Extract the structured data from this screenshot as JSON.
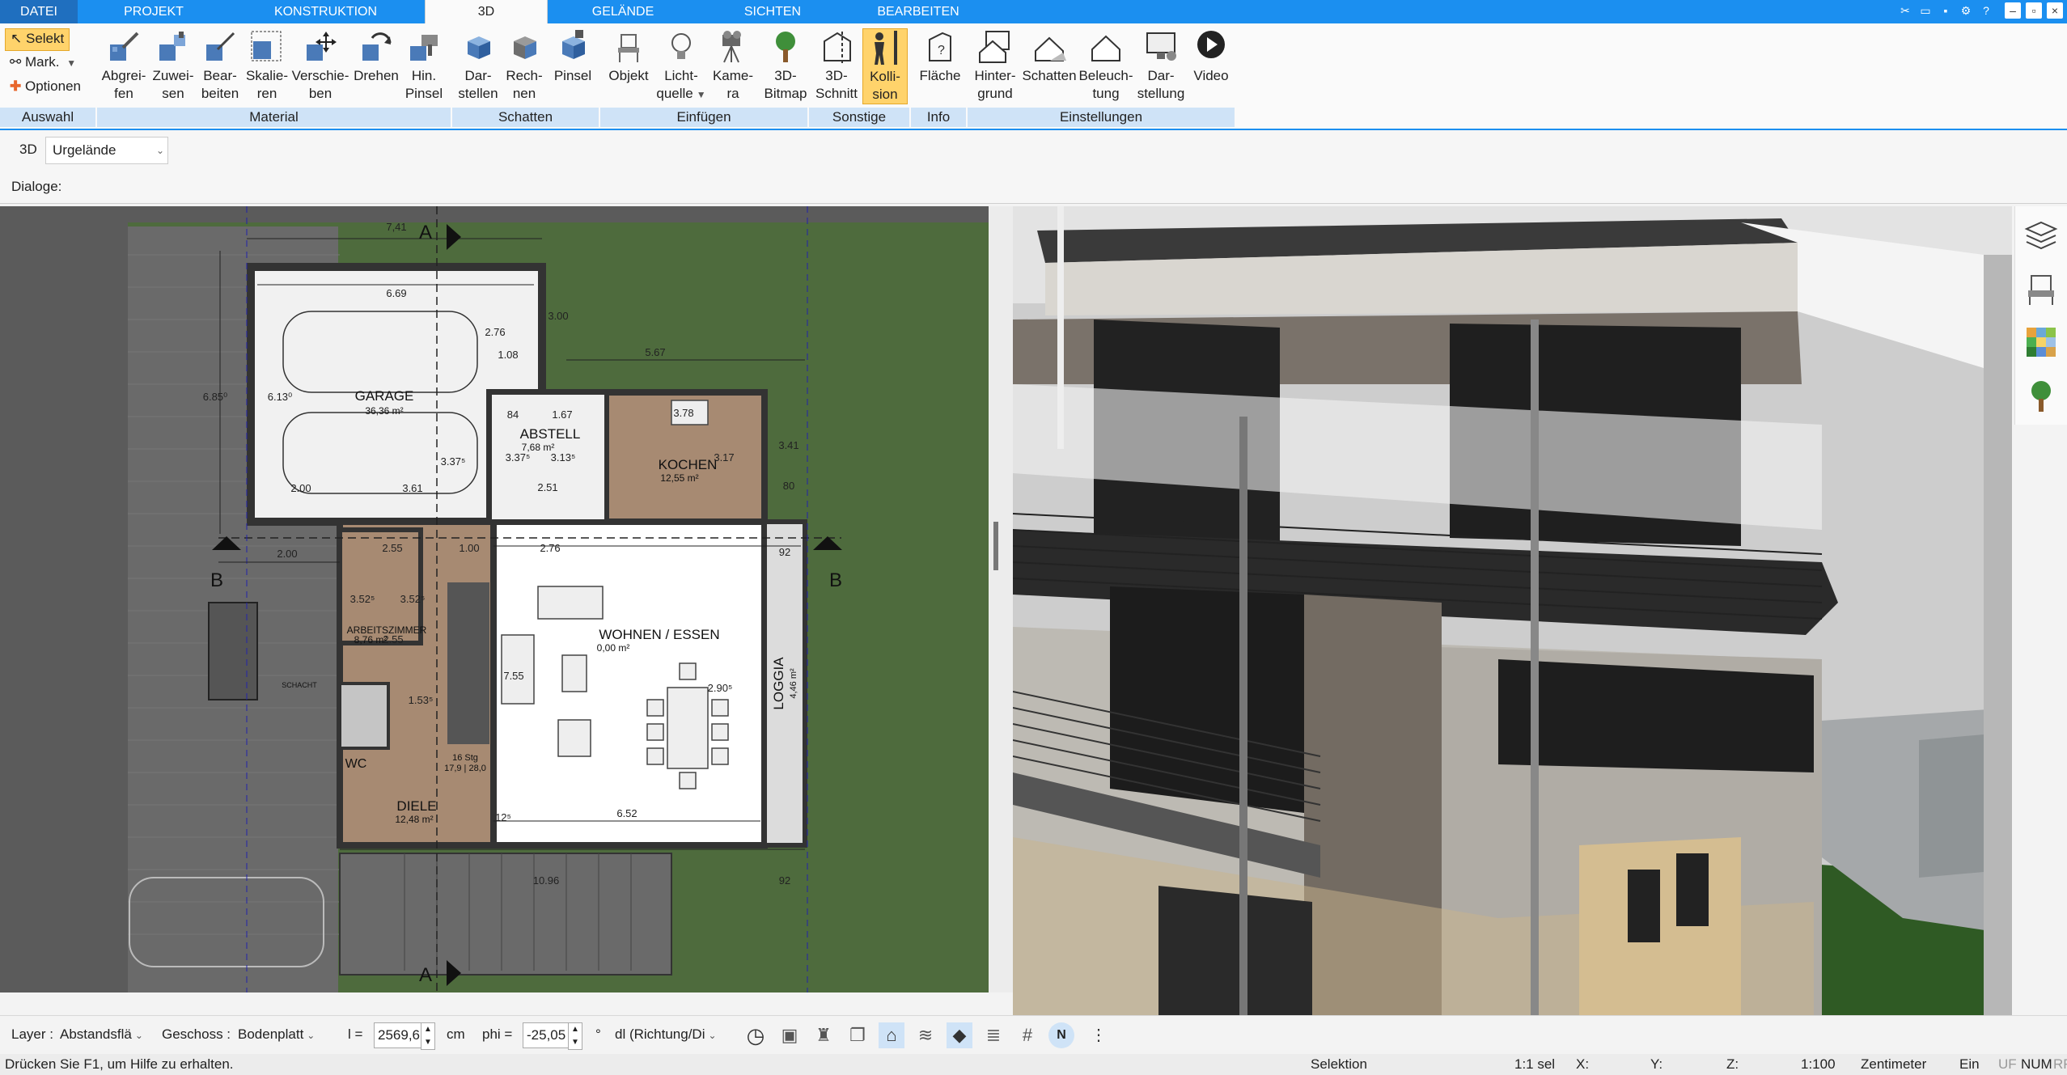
{
  "tabs": [
    {
      "label": "DATEI"
    },
    {
      "label": "PROJEKT"
    },
    {
      "label": "KONSTRUKTION"
    },
    {
      "label": "3D"
    },
    {
      "label": "GELÄNDE"
    },
    {
      "label": "SICHTEN"
    },
    {
      "label": "BEARBEITEN"
    }
  ],
  "selection": {
    "select": "Selekt",
    "mark": "Mark.",
    "options": "Optionen",
    "group": "Auswahl"
  },
  "ribbon_buttons": {
    "abgreifen": {
      "l1": "Abgrei-",
      "l2": "fen"
    },
    "zuweisen": {
      "l1": "Zuwei-",
      "l2": "sen"
    },
    "bearbeiten": {
      "l1": "Bear-",
      "l2": "beiten"
    },
    "skalieren": {
      "l1": "Skalie-",
      "l2": "ren"
    },
    "verschieben": {
      "l1": "Verschie-",
      "l2": "ben"
    },
    "drehen": {
      "l1": "Drehen",
      "l2": ""
    },
    "hinpinsel": {
      "l1": "Hin.",
      "l2": "Pinsel"
    },
    "darstellen": {
      "l1": "Dar-",
      "l2": "stellen"
    },
    "rechnen": {
      "l1": "Rech-",
      "l2": "nen"
    },
    "pinsel": {
      "l1": "Pinsel",
      "l2": ""
    },
    "objekt": {
      "l1": "Objekt",
      "l2": ""
    },
    "lichtquelle": {
      "l1": "Licht-",
      "l2": "quelle"
    },
    "kamera": {
      "l1": "Kame-",
      "l2": "ra"
    },
    "bitmap": {
      "l1": "3D-",
      "l2": "Bitmap"
    },
    "schnitt": {
      "l1": "3D-",
      "l2": "Schnitt"
    },
    "kollision": {
      "l1": "Kolli-",
      "l2": "sion"
    },
    "flaeche": {
      "l1": "Fläche",
      "l2": ""
    },
    "hintergrund": {
      "l1": "Hinter-",
      "l2": "grund"
    },
    "schatten": {
      "l1": "Schatten",
      "l2": ""
    },
    "beleuchtung": {
      "l1": "Beleuch-",
      "l2": "tung"
    },
    "darstellung": {
      "l1": "Dar-",
      "l2": "stellung"
    },
    "video": {
      "l1": "Video",
      "l2": ""
    }
  },
  "groups": {
    "material": "Material",
    "schatten": "Schatten",
    "einfuegen": "Einfügen",
    "sonstige": "Sonstige",
    "info": "Info",
    "einstellungen": "Einstellungen"
  },
  "bar3d": {
    "label": "3D",
    "value": "Urgelände"
  },
  "dialog": {
    "label": "Dialoge:"
  },
  "plan": {
    "dims": {
      "top_total": "7,41",
      "garage_w": "6.69",
      "d_567": "5.67",
      "d_300": "3.00",
      "d_276": "2.76",
      "d_108": "1.08",
      "d_685": "6.85⁰",
      "d_613": "6.13⁰",
      "d_337": "3.37⁵",
      "d_200a": "2.00",
      "d_361": "3.61",
      "d_200b": "2.00",
      "d_255": "2.55",
      "d_100": "1.00",
      "d_276b": "2.76",
      "d_92": "92",
      "d_84": "84",
      "d_167": "1.67",
      "d_378": "3.78",
      "d_341": "3.41",
      "d_80": "80",
      "d_251": "2.51",
      "d_352a": "3.52⁵",
      "d_352b": "3.52⁵",
      "d_255b": "2.55",
      "d_153": "1.53⁵",
      "d_755": "7.55",
      "d_290": "2.90⁵",
      "d_652": "6.52",
      "d_1096": "10.96",
      "d_92b": "92",
      "d_12": "12⁵",
      "d_327": "3.37⁵",
      "d_317": "3.17",
      "d_313": "3.13⁵"
    },
    "rooms": {
      "garage": {
        "name": "GARAGE",
        "area": "36,36 m²"
      },
      "abstell": {
        "name": "ABSTELL",
        "area": "7,68 m²"
      },
      "kochen": {
        "name": "KOCHEN",
        "area": "12,55 m²"
      },
      "arbeitszimmer": {
        "name": "ARBEITSZIMMER",
        "area": "8,76 m²"
      },
      "wohnen": {
        "name": "WOHNEN / ESSEN",
        "area": "0,00 m²"
      },
      "loggia": {
        "name": "LOGGIA",
        "area": "4,46 m²"
      },
      "wc": {
        "name": "WC",
        "area": ""
      },
      "diele": {
        "name": "DIELE",
        "area": "12,48 m²"
      },
      "schacht": {
        "name": "SCHACHT",
        "area": ""
      },
      "stair": {
        "name": "16 Stg",
        "area": "17,9 | 28,0"
      }
    },
    "section_marks": {
      "a": "A",
      "b": "B"
    }
  },
  "bottom": {
    "layer_label": "Layer :",
    "layer_value": "Abstandsflä",
    "geschoss_label": "Geschoss :",
    "geschoss_value": "Bodenplatt",
    "l_label": "l =",
    "l_value": "2569,6",
    "l_unit": "cm",
    "phi_label": "phi =",
    "phi_value": "-25,05",
    "phi_unit": "°",
    "dl_value": "dl (Richtung/Di"
  },
  "status": {
    "hint": "Drücken Sie F1, um Hilfe zu erhalten.",
    "mode": "Selektion",
    "sel": "1:1 sel",
    "x": "X:",
    "y": "Y:",
    "z": "Z:",
    "scale": "1:100",
    "unit": "Zentimeter",
    "ein": "Ein",
    "uf": "UF",
    "num": "NUM",
    "rf": "RF"
  },
  "colors": {
    "tabbar": "#1b8ff0",
    "ribbon_active": "#ffd36b",
    "plan_grass": "#4e6b3d",
    "plan_bg": "#5b5b5b"
  }
}
